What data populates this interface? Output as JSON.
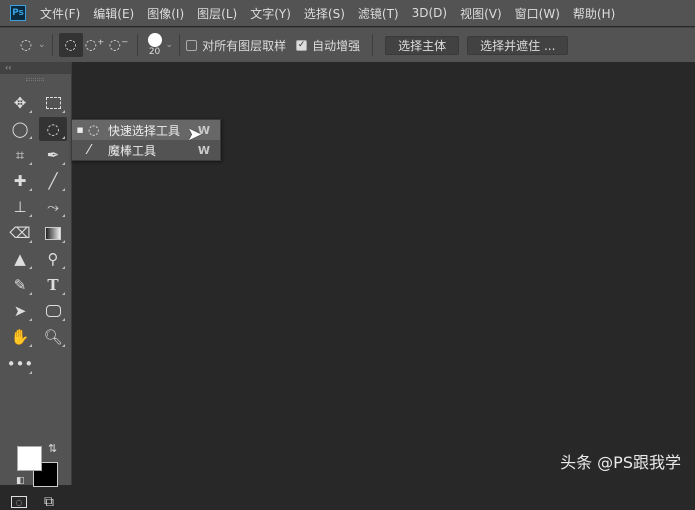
{
  "menubar": {
    "logo": "Ps",
    "items": [
      "文件(F)",
      "编辑(E)",
      "图像(I)",
      "图层(L)",
      "文字(Y)",
      "选择(S)",
      "滤镜(T)",
      "3D(D)",
      "视图(V)",
      "窗口(W)",
      "帮助(H)"
    ]
  },
  "options": {
    "brush_size": "20",
    "sample_all_layers": {
      "label": "对所有图层取样",
      "checked": false
    },
    "auto_enhance": {
      "label": "自动增强",
      "checked": true
    },
    "select_subject": "选择主体",
    "select_and_mask": "选择并遮住 ..."
  },
  "toolbar": {
    "collapse": "‹‹",
    "tools": [
      "move",
      "rectangular-marquee",
      "lasso",
      "quick-selection",
      "crop",
      "eyedropper",
      "spot-healing-brush",
      "brush",
      "clone-stamp",
      "history-brush",
      "eraser",
      "gradient",
      "blur",
      "dodge",
      "pen",
      "type",
      "path-selection",
      "rectangle",
      "hand",
      "zoom",
      "edit-toolbar"
    ],
    "foreground_color": "#ffffff",
    "background_color": "#000000"
  },
  "flyout": {
    "items": [
      {
        "label": "快速选择工具",
        "shortcut": "W",
        "active": true
      },
      {
        "label": "魔棒工具",
        "shortcut": "W",
        "active": false
      }
    ]
  },
  "watermark": "头条 @PS跟我学"
}
